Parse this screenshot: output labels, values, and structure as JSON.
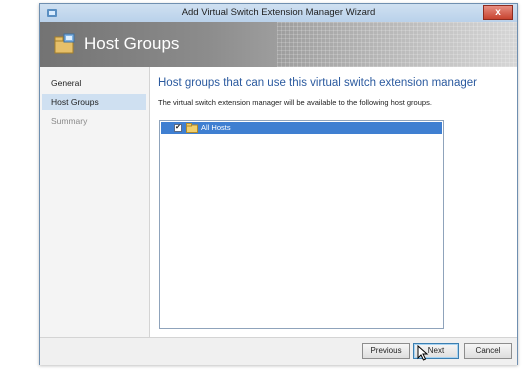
{
  "window": {
    "title": "Add Virtual Switch Extension Manager Wizard",
    "close_label": "x"
  },
  "banner": {
    "title": "Host Groups"
  },
  "sidebar": {
    "items": [
      {
        "label": "General",
        "state": "normal"
      },
      {
        "label": "Host Groups",
        "state": "selected"
      },
      {
        "label": "Summary",
        "state": "disabled"
      }
    ]
  },
  "main": {
    "heading": "Host groups that can use this virtual switch extension manager",
    "description": "The virtual switch extension manager will be available to the following host groups.",
    "tree": {
      "items": [
        {
          "label": "All Hosts",
          "checked": true,
          "check_glyph": "✔"
        }
      ]
    }
  },
  "footer": {
    "previous_label": "Previous",
    "next_label": "Next",
    "cancel_label": "Cancel"
  },
  "colors": {
    "heading": "#2b5a9f",
    "selected_nav": "#cfe0f1",
    "tree_selection": "#3f7fd1",
    "close_button": "#c7432f"
  },
  "icons": {
    "app": "wizard-app-icon",
    "banner": "host-groups-icon",
    "folder": "folder-icon",
    "close": "close-icon",
    "cursor": "mouse-pointer-icon"
  }
}
